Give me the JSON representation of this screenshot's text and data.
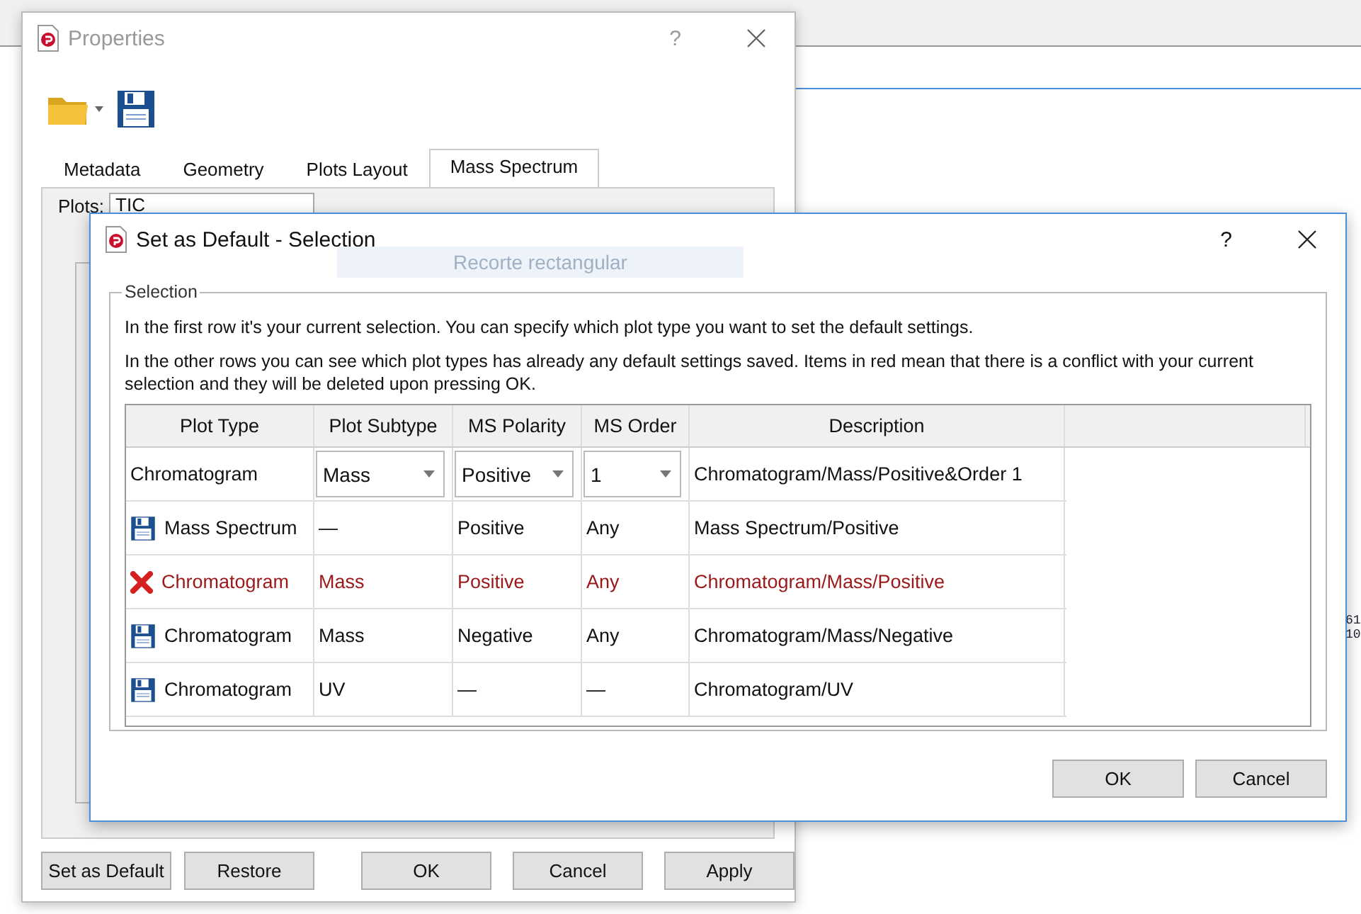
{
  "background": {
    "fragments": [
      "61",
      "10"
    ]
  },
  "properties_window": {
    "title": "Properties",
    "help": "?",
    "tabs": [
      {
        "label": "Metadata",
        "selected": false
      },
      {
        "label": "Geometry",
        "selected": false
      },
      {
        "label": "Plots Layout",
        "selected": false
      },
      {
        "label": "Mass Spectrum",
        "selected": true
      }
    ],
    "plots_label": "Plots:",
    "plots_value": "TIC",
    "buttons": [
      "Set as Default",
      "Restore",
      "OK",
      "Cancel",
      "Apply"
    ]
  },
  "ghost_label": "Recorte rectangular",
  "selection_dialog": {
    "title": "Set as Default - Selection",
    "help": "?",
    "group_title": "Selection",
    "paragraphs": [
      "In the first row it's your current selection. You can specify which plot type you want to set the default settings.",
      "In the other rows you can see which plot types has already any default settings saved. Items in red mean that there is a conflict with your current selection and they will be deleted upon pressing OK."
    ],
    "table": {
      "columns": [
        "Plot Type",
        "Plot Subtype",
        "MS Polarity",
        "MS Order",
        "Description"
      ],
      "rows": [
        {
          "kind": "current",
          "cells": [
            {
              "kind": "text",
              "value": "Chromatogram"
            },
            {
              "kind": "dropdown",
              "value": "Mass"
            },
            {
              "kind": "dropdown",
              "value": "Positive"
            },
            {
              "kind": "dropdown",
              "value": "1"
            },
            {
              "kind": "text",
              "value": "Chromatogram/Mass/Positive&Order 1"
            }
          ]
        },
        {
          "kind": "saved",
          "cells": [
            {
              "kind": "text",
              "value": "Mass Spectrum"
            },
            {
              "kind": "text",
              "value": "—"
            },
            {
              "kind": "text",
              "value": "Positive"
            },
            {
              "kind": "text",
              "value": "Any"
            },
            {
              "kind": "text",
              "value": "Mass Spectrum/Positive"
            }
          ]
        },
        {
          "kind": "conflict",
          "cells": [
            {
              "kind": "text",
              "value": "Chromatogram"
            },
            {
              "kind": "text",
              "value": "Mass"
            },
            {
              "kind": "text",
              "value": "Positive"
            },
            {
              "kind": "text",
              "value": "Any"
            },
            {
              "kind": "text",
              "value": "Chromatogram/Mass/Positive"
            }
          ]
        },
        {
          "kind": "saved",
          "cells": [
            {
              "kind": "text",
              "value": "Chromatogram"
            },
            {
              "kind": "text",
              "value": "Mass"
            },
            {
              "kind": "text",
              "value": "Negative"
            },
            {
              "kind": "text",
              "value": "Any"
            },
            {
              "kind": "text",
              "value": "Chromatogram/Mass/Negative"
            }
          ]
        },
        {
          "kind": "saved",
          "cells": [
            {
              "kind": "text",
              "value": "Chromatogram"
            },
            {
              "kind": "text",
              "value": "UV"
            },
            {
              "kind": "text",
              "value": "—"
            },
            {
              "kind": "text",
              "value": "—"
            },
            {
              "kind": "text",
              "value": "Chromatogram/UV"
            }
          ]
        }
      ]
    },
    "buttons": [
      "OK",
      "Cancel"
    ]
  }
}
